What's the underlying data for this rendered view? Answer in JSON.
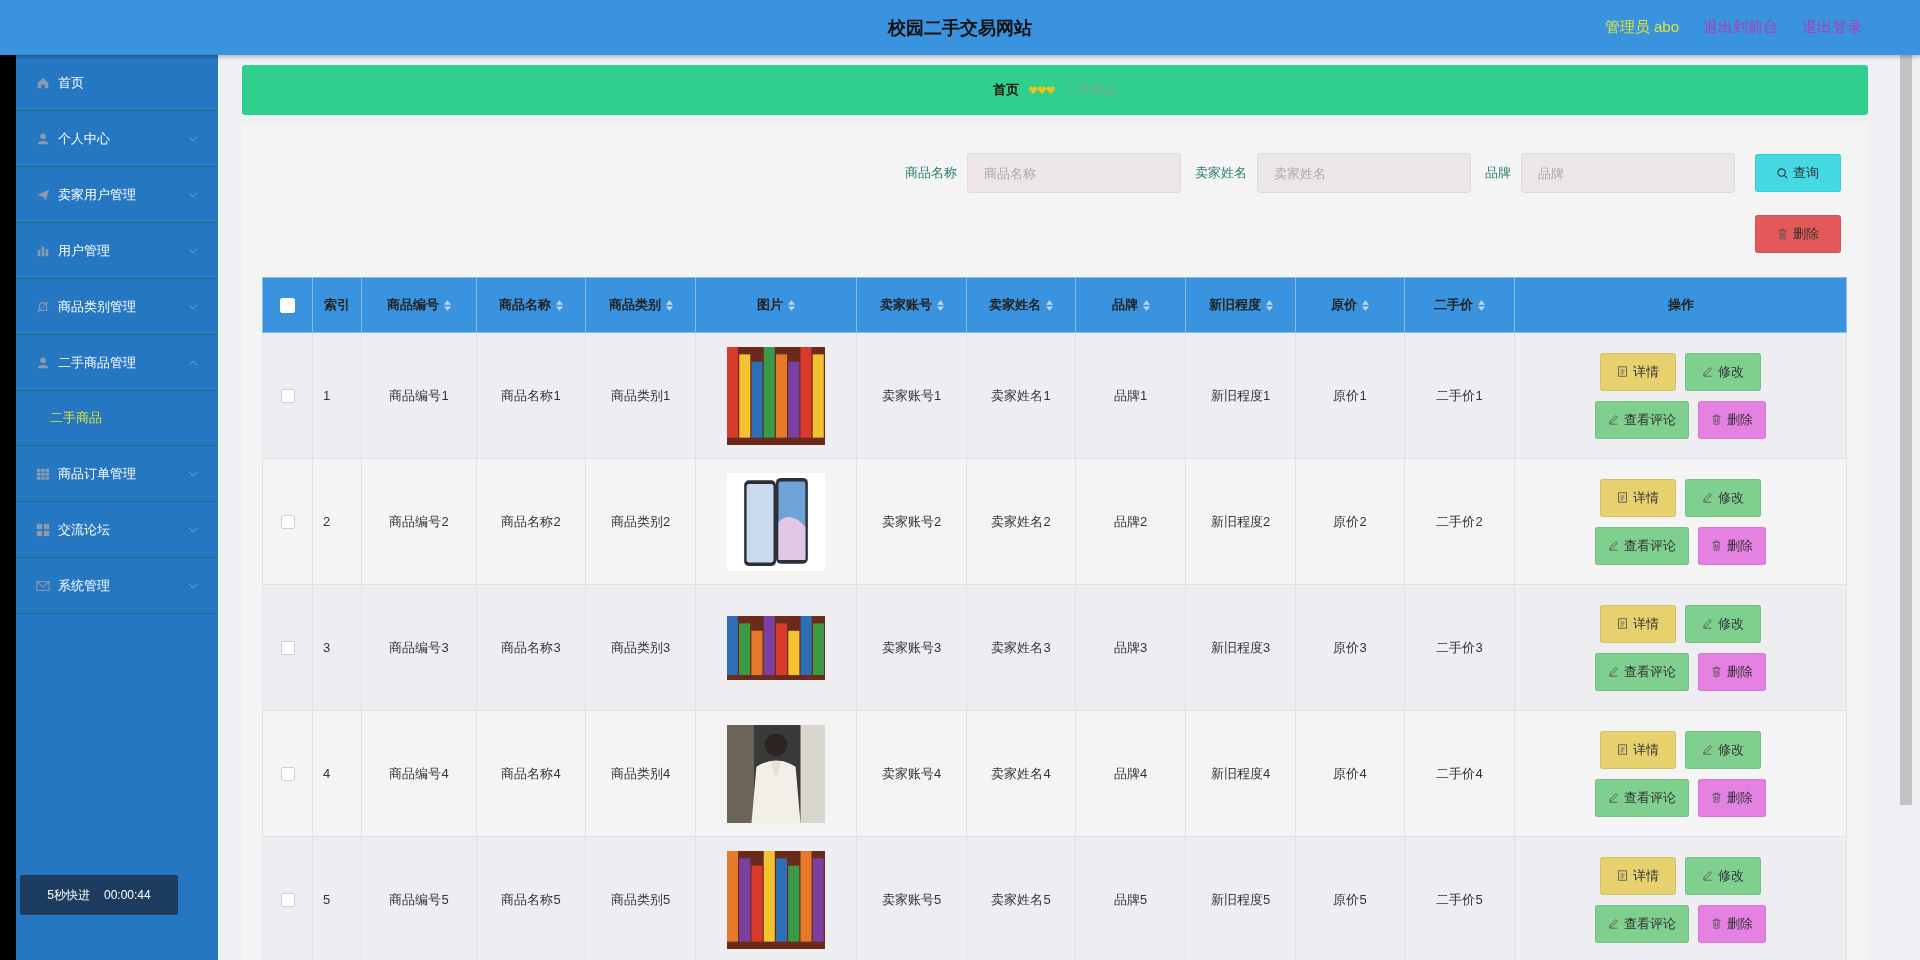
{
  "header": {
    "title": "校园二手交易网站",
    "user": "管理员 abo",
    "links": [
      "退出到前台",
      "退出登录"
    ]
  },
  "sidebar": {
    "items": [
      {
        "label": "首页",
        "has_arrow": false
      },
      {
        "label": "个人中心",
        "expanded": false,
        "has_arrow": true
      },
      {
        "label": "卖家用户管理",
        "expanded": false,
        "has_arrow": true
      },
      {
        "label": "用户管理",
        "expanded": false,
        "has_arrow": true
      },
      {
        "label": "商品类别管理",
        "expanded": false,
        "has_arrow": true
      },
      {
        "label": "二手商品管理",
        "expanded": true,
        "has_arrow": true,
        "children": [
          {
            "label": "二手商品",
            "selected": true
          }
        ]
      },
      {
        "label": "商品订单管理",
        "expanded": false,
        "has_arrow": true
      },
      {
        "label": "交流论坛",
        "expanded": false,
        "has_arrow": true
      },
      {
        "label": "系统管理",
        "expanded": false,
        "has_arrow": true
      }
    ]
  },
  "breadcrumb": [
    {
      "label": "首页",
      "current": false
    },
    {
      "label": "二手商品",
      "current": true
    }
  ],
  "search": {
    "fields": [
      {
        "label": "商品名称",
        "placeholder": "商品名称"
      },
      {
        "label": "卖家姓名",
        "placeholder": "卖家姓名"
      },
      {
        "label": "品牌",
        "placeholder": "品牌"
      }
    ],
    "query_button": "查询",
    "delete_button": "删除"
  },
  "table": {
    "select_all": false,
    "columns": [
      {
        "label": "索引",
        "sortable": false
      },
      {
        "label": "商品编号",
        "sortable": true
      },
      {
        "label": "商品名称",
        "sortable": true
      },
      {
        "label": "商品类别",
        "sortable": true
      },
      {
        "label": "图片",
        "sortable": true
      },
      {
        "label": "卖家账号",
        "sortable": true
      },
      {
        "label": "卖家姓名",
        "sortable": true
      },
      {
        "label": "品牌",
        "sortable": true
      },
      {
        "label": "新旧程度",
        "sortable": true
      },
      {
        "label": "原价",
        "sortable": true
      },
      {
        "label": "二手价",
        "sortable": true
      },
      {
        "label": "操作",
        "sortable": false
      }
    ],
    "rows": [
      {
        "checked": false,
        "cells": [
          "1",
          "商品编号1",
          "商品名称1",
          "商品类别1",
          {
            "kind": "picture"
          },
          "卖家账号1",
          "卖家姓名1",
          "品牌1",
          "新旧程度1",
          "原价1",
          "二手价1"
        ],
        "actions": [
          {
            "kind": "detail",
            "label": "详情"
          },
          {
            "kind": "edit",
            "label": "修改"
          },
          {
            "kind": "comments",
            "label": "查看评论"
          },
          {
            "kind": "delete",
            "label": "删除"
          }
        ]
      },
      {
        "checked": false,
        "cells": [
          "2",
          "商品编号2",
          "商品名称2",
          "商品类别2",
          {
            "kind": "picture"
          },
          "卖家账号2",
          "卖家姓名2",
          "品牌2",
          "新旧程度2",
          "原价2",
          "二手价2"
        ],
        "actions": [
          {
            "kind": "detail",
            "label": "详情"
          },
          {
            "kind": "edit",
            "label": "修改"
          },
          {
            "kind": "comments",
            "label": "查看评论"
          },
          {
            "kind": "delete",
            "label": "删除"
          }
        ]
      },
      {
        "checked": false,
        "cells": [
          "3",
          "商品编号3",
          "商品名称3",
          "商品类别3",
          {
            "kind": "picture"
          },
          "卖家账号3",
          "卖家姓名3",
          "品牌3",
          "新旧程度3",
          "原价3",
          "二手价3"
        ],
        "actions": [
          {
            "kind": "detail",
            "label": "详情"
          },
          {
            "kind": "edit",
            "label": "修改"
          },
          {
            "kind": "comments",
            "label": "查看评论"
          },
          {
            "kind": "delete",
            "label": "删除"
          }
        ]
      },
      {
        "checked": false,
        "cells": [
          "4",
          "商品编号4",
          "商品名称4",
          "商品类别4",
          {
            "kind": "picture"
          },
          "卖家账号4",
          "卖家姓名4",
          "品牌4",
          "新旧程度4",
          "原价4",
          "二手价4"
        ],
        "actions": [
          {
            "kind": "detail",
            "label": "详情"
          },
          {
            "kind": "edit",
            "label": "修改"
          },
          {
            "kind": "comments",
            "label": "查看评论"
          },
          {
            "kind": "delete",
            "label": "删除"
          }
        ]
      },
      {
        "checked": false,
        "cells": [
          "5",
          "商品编号5",
          "商品名称5",
          "商品类别5",
          {
            "kind": "picture"
          },
          "卖家账号5",
          "卖家姓名5",
          "品牌5",
          "新旧程度5",
          "原价5",
          "二手价5"
        ],
        "actions": [
          {
            "kind": "detail",
            "label": "详情"
          },
          {
            "kind": "edit",
            "label": "修改"
          },
          {
            "kind": "comments",
            "label": "查看评论"
          },
          {
            "kind": "delete",
            "label": "删除"
          }
        ]
      }
    ]
  },
  "player_overlay": {
    "label": "5秒快进",
    "time": "00:00:44"
  }
}
